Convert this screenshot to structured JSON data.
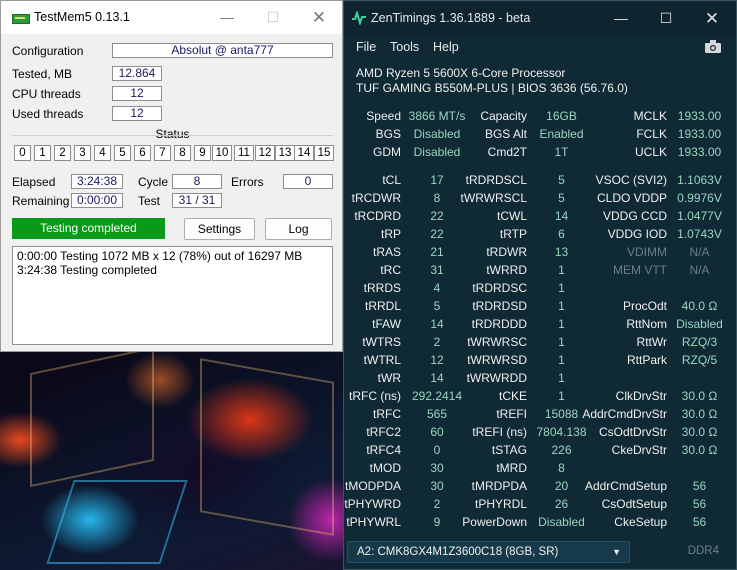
{
  "testmem": {
    "title": "TestMem5  0.13.1",
    "configuration_label": "Configuration",
    "configuration_value": "Absolut @ anta777",
    "tested_label": "Tested, MB",
    "tested_value": "12.864",
    "cpu_threads_label": "CPU threads",
    "cpu_threads_value": "12",
    "used_threads_label": "Used threads",
    "used_threads_value": "12",
    "status_label": "Status",
    "status_boxes": [
      "0",
      "1",
      "2",
      "3",
      "4",
      "5",
      "6",
      "7",
      "8",
      "9",
      "10",
      "11",
      "12",
      "13",
      "14",
      "15"
    ],
    "elapsed_label": "Elapsed",
    "elapsed_value": "3:24:38",
    "cycle_label": "Cycle",
    "cycle_value": "8",
    "errors_label": "Errors",
    "errors_value": "0",
    "remaining_label": "Remaining",
    "remaining_value": "0:00:00",
    "test_label": "Test",
    "test_value": "31 / 31",
    "status_button": "Testing completed",
    "settings_button": "Settings",
    "log_button": "Log",
    "log_lines": [
      "0:00:00  Testing 1072 MB x 12 (78%) out of 16297 MB",
      "3:24:38  Testing completed"
    ],
    "colors": {
      "status_bg": "#0a9a1a"
    }
  },
  "zentimings": {
    "title": "ZenTimings 1.36.1889 - beta",
    "menu": [
      "File",
      "Tools",
      "Help"
    ],
    "cpu": "AMD Ryzen 5 5600X 6-Core Processor",
    "board": "TUF GAMING B550M-PLUS | BIOS 3636 (56.76.0)",
    "col1": [
      {
        "label": "Speed",
        "value": "3866 MT/s"
      },
      {
        "label": "BGS",
        "value": "Disabled"
      },
      {
        "label": "GDM",
        "value": "Disabled"
      },
      {
        "label": "tCL",
        "value": "17"
      },
      {
        "label": "tRCDWR",
        "value": "8"
      },
      {
        "label": "tRCDRD",
        "value": "22"
      },
      {
        "label": "tRP",
        "value": "22"
      },
      {
        "label": "tRAS",
        "value": "21"
      },
      {
        "label": "tRC",
        "value": "31"
      },
      {
        "label": "tRRDS",
        "value": "4"
      },
      {
        "label": "tRRDL",
        "value": "5"
      },
      {
        "label": "tFAW",
        "value": "14"
      },
      {
        "label": "tWTRS",
        "value": "2"
      },
      {
        "label": "tWTRL",
        "value": "12"
      },
      {
        "label": "tWR",
        "value": "14"
      },
      {
        "label": "tRFC (ns)",
        "value": "292.2414"
      },
      {
        "label": "tRFC",
        "value": "565"
      },
      {
        "label": "tRFC2",
        "value": "60"
      },
      {
        "label": "tRFC4",
        "value": "0"
      },
      {
        "label": "tMOD",
        "value": "30"
      },
      {
        "label": "tMODPDA",
        "value": "30"
      },
      {
        "label": "tPHYWRD",
        "value": "2"
      },
      {
        "label": "tPHYWRL",
        "value": "9"
      }
    ],
    "col2": [
      {
        "label": "Capacity",
        "value": "16GB"
      },
      {
        "label": "BGS Alt",
        "value": "Enabled"
      },
      {
        "label": "Cmd2T",
        "value": "1T"
      },
      {
        "label": "tRDRDSCL",
        "value": "5"
      },
      {
        "label": "tWRWRSCL",
        "value": "5"
      },
      {
        "label": "tCWL",
        "value": "14"
      },
      {
        "label": "tRTP",
        "value": "6"
      },
      {
        "label": "tRDWR",
        "value": "13"
      },
      {
        "label": "tWRRD",
        "value": "1"
      },
      {
        "label": "tRDRDSC",
        "value": "1"
      },
      {
        "label": "tRDRDSD",
        "value": "1"
      },
      {
        "label": "tRDRDDD",
        "value": "1"
      },
      {
        "label": "tWRWRSC",
        "value": "1"
      },
      {
        "label": "tWRWRSD",
        "value": "1"
      },
      {
        "label": "tWRWRDD",
        "value": "1"
      },
      {
        "label": "tCKE",
        "value": "1"
      },
      {
        "label": "tREFI",
        "value": "15088"
      },
      {
        "label": "tREFI (ns)",
        "value": "7804.138"
      },
      {
        "label": "tSTAG",
        "value": "226"
      },
      {
        "label": "tMRD",
        "value": "8"
      },
      {
        "label": "tMRDPDA",
        "value": "20"
      },
      {
        "label": "tPHYRDL",
        "value": "26"
      },
      {
        "label": "PowerDown",
        "value": "Disabled"
      }
    ],
    "col3": [
      {
        "label": "MCLK",
        "value": "1933.00"
      },
      {
        "label": "FCLK",
        "value": "1933.00"
      },
      {
        "label": "UCLK",
        "value": "1933.00"
      },
      {
        "label": "VSOC (SVI2)",
        "value": "1.1063V"
      },
      {
        "label": "CLDO VDDP",
        "value": "0.9976V"
      },
      {
        "label": "VDDG CCD",
        "value": "1.0477V"
      },
      {
        "label": "VDDG IOD",
        "value": "1.0743V"
      },
      {
        "label": "VDIMM",
        "value": "N/A"
      },
      {
        "label": "MEM VTT",
        "value": "N/A"
      },
      {
        "label": "",
        "value": ""
      },
      {
        "label": "ProcOdt",
        "value": "40.0 Ω"
      },
      {
        "label": "RttNom",
        "value": "Disabled"
      },
      {
        "label": "RttWr",
        "value": "RZQ/3"
      },
      {
        "label": "RttPark",
        "value": "RZQ/5"
      },
      {
        "label": "",
        "value": ""
      },
      {
        "label": "ClkDrvStr",
        "value": "30.0 Ω"
      },
      {
        "label": "AddrCmdDrvStr",
        "value": "30.0 Ω"
      },
      {
        "label": "CsOdtDrvStr",
        "value": "30.0 Ω"
      },
      {
        "label": "CkeDrvStr",
        "value": "30.0 Ω"
      },
      {
        "label": "",
        "value": ""
      },
      {
        "label": "AddrCmdSetup",
        "value": "56"
      },
      {
        "label": "CsOdtSetup",
        "value": "56"
      },
      {
        "label": "CkeSetup",
        "value": "56"
      }
    ],
    "dimm_select": "A2: CMK8GX4M1Z3600C18 (8GB, SR)",
    "memory_type": "DDR4"
  }
}
